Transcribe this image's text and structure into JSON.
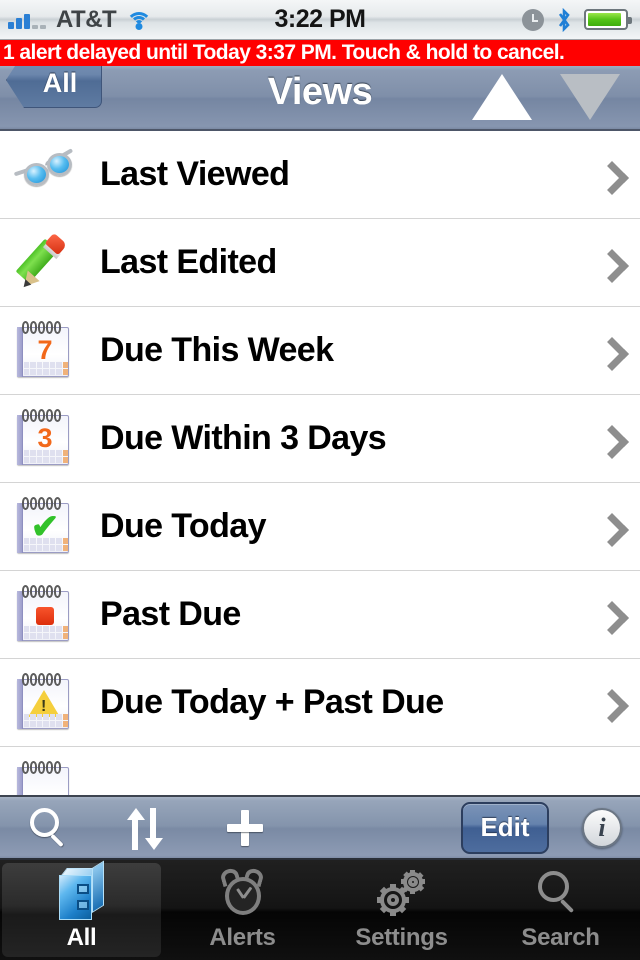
{
  "status_bar": {
    "carrier": "AT&T",
    "time": "3:22 PM",
    "signal_bars_filled": 3,
    "signal_bars_total": 5,
    "wifi_icon": "wifi-icon",
    "alarm_icon": "alarm-clock-icon",
    "bluetooth_icon": "bluetooth-icon",
    "battery_icon": "battery-icon",
    "battery_color": "#4fbf12"
  },
  "alert_banner": {
    "text": "1 alert delayed until Today 3:37 PM. Touch & hold to cancel.",
    "background_color": "#ff0000",
    "text_color": "#ffffff"
  },
  "nav_bar": {
    "back_label": "All",
    "title": "Views",
    "up_arrow_enabled": true,
    "down_arrow_enabled": false,
    "up_arrow_color": "#ffffff",
    "down_arrow_color": "#b9bec4"
  },
  "list": {
    "rows": [
      {
        "label": "Last Viewed",
        "icon": "eyeglasses-icon",
        "chevron": true
      },
      {
        "label": "Last Edited",
        "icon": "pencil-icon",
        "chevron": true
      },
      {
        "label": "Due This Week",
        "icon": "calendar-7-icon",
        "chevron": true
      },
      {
        "label": "Due Within 3 Days",
        "icon": "calendar-3-icon",
        "chevron": true
      },
      {
        "label": "Due Today",
        "icon": "calendar-check-icon",
        "chevron": true
      },
      {
        "label": "Past Due",
        "icon": "calendar-red-square-icon",
        "chevron": true
      },
      {
        "label": "Due Today + Past Due",
        "icon": "calendar-warning-icon",
        "chevron": true
      }
    ],
    "partial_row_icon": "calendar-icon"
  },
  "toolbar": {
    "search_icon": "search-icon",
    "sort_icon": "sort-arrows-icon",
    "add_icon": "plus-icon",
    "edit_label": "Edit",
    "info_icon": "info-icon",
    "info_glyph": "i"
  },
  "tab_bar": {
    "tabs": [
      {
        "label": "All",
        "icon": "box-icon",
        "active": true
      },
      {
        "label": "Alerts",
        "icon": "alarm-clock-icon",
        "active": false
      },
      {
        "label": "Settings",
        "icon": "gears-icon",
        "active": false
      },
      {
        "label": "Search",
        "icon": "search-icon",
        "active": false
      }
    ],
    "active_label_color": "#ffffff",
    "inactive_label_color": "#8d8d8d"
  }
}
